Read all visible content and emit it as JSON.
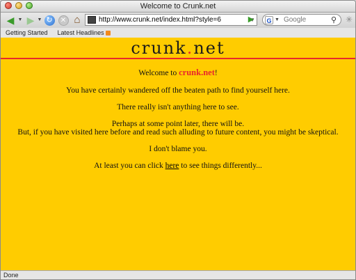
{
  "window": {
    "title": "Welcome to Crunk.net"
  },
  "toolbar": {
    "url": "http://www.crunk.net/index.html?style=6",
    "search_placeholder": "Google",
    "search_engine_letter": "G"
  },
  "bookmarks": [
    {
      "label": "Getting Started"
    },
    {
      "label": "Latest Headlines"
    }
  ],
  "page": {
    "logo_left": "crunk",
    "logo_dot": ".",
    "logo_right": "net",
    "welcome_prefix": "Welcome to ",
    "welcome_site": "crunk.net",
    "welcome_suffix": "!",
    "line2": "You have certainly wandered off the beaten path to find yourself here.",
    "line3": "There really isn't anything here to see.",
    "line4a": "Perhaps at some point later, there will be.",
    "line4b": "But, if you have visited here before and read such alluding to future content, you might be skeptical.",
    "line5": "I don't blame you.",
    "line6_prefix": "At least you can click ",
    "line6_link": "here",
    "line6_suffix": " to see things differently..."
  },
  "status": {
    "text": "Done"
  },
  "colors": {
    "page_background": "#ffcc00",
    "accent_red": "#e8282b"
  }
}
